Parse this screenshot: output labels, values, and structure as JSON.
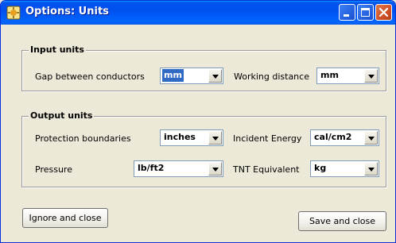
{
  "window": {
    "title": "Options: Units"
  },
  "input_units": {
    "title": "Input units",
    "gap": {
      "label": "Gap between conductors",
      "value": "mm"
    },
    "working": {
      "label": "Working distance",
      "value": "mm"
    }
  },
  "output_units": {
    "title": "Output units",
    "protection": {
      "label": "Protection boundaries",
      "value": "inches"
    },
    "incident": {
      "label": "Incident Energy",
      "value": "cal/cm2"
    },
    "pressure": {
      "label": "Pressure",
      "value": "lb/ft2"
    },
    "tnt": {
      "label": "TNT Equivalent",
      "value": "kg"
    }
  },
  "buttons": {
    "ignore": "Ignore and close",
    "save": "Save and close"
  }
}
